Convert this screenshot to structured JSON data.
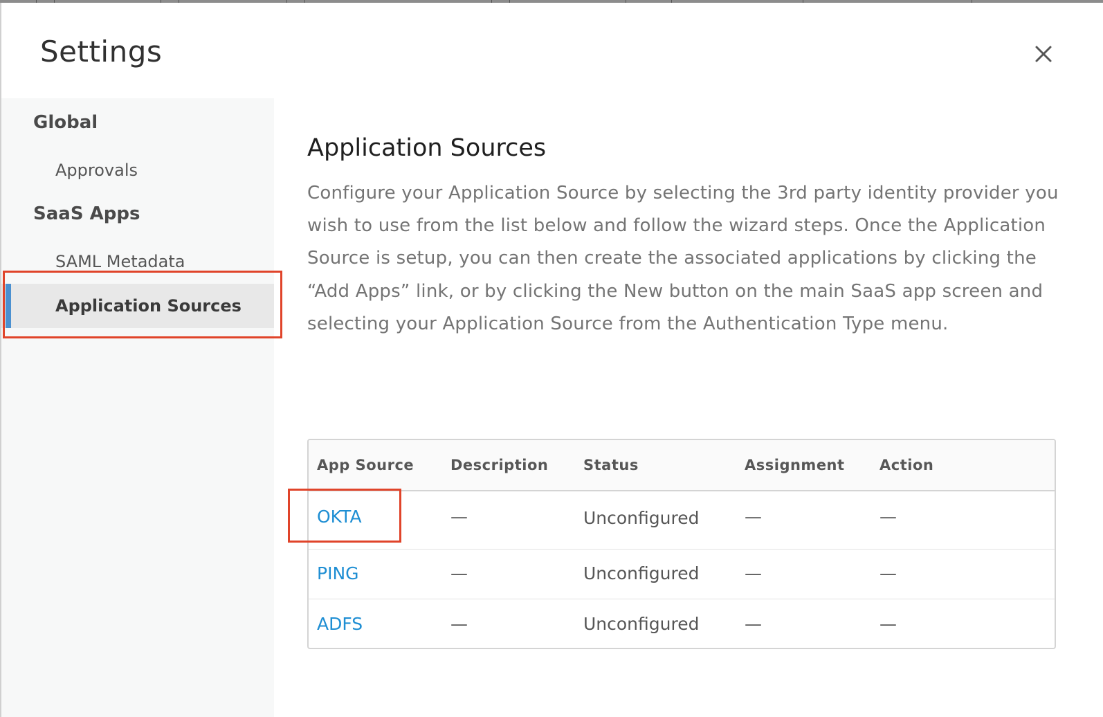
{
  "modal": {
    "title": "Settings",
    "close_icon": "close-icon"
  },
  "sidebar": {
    "groups": [
      {
        "label": "Global",
        "items": [
          {
            "label": "Approvals",
            "active": false
          }
        ]
      },
      {
        "label": "SaaS Apps",
        "items": [
          {
            "label": "SAML Metadata",
            "active": false
          },
          {
            "label": "Application Sources",
            "active": true
          }
        ]
      }
    ]
  },
  "main": {
    "title": "Application Sources",
    "description": "Configure your Application Source by selecting the 3rd party identity provider you wish to use from the list below and follow the wizard steps. Once the Application Source is setup, you can then create the associated applications by clicking the “Add Apps” link, or by clicking the New button on the main SaaS app screen and selecting your Application Source from the Authentication Type menu.",
    "table": {
      "columns": [
        "App Source",
        "Description",
        "Status",
        "Assignment",
        "Action"
      ],
      "rows": [
        {
          "app_source": "OKTA",
          "description": "—",
          "status": "Unconfigured",
          "assignment": "—",
          "action": "—"
        },
        {
          "app_source": "PING",
          "description": "—",
          "status": "Unconfigured",
          "assignment": "—",
          "action": "—"
        },
        {
          "app_source": "ADFS",
          "description": "—",
          "status": "Unconfigured",
          "assignment": "—",
          "action": "—"
        }
      ]
    }
  },
  "colors": {
    "link": "#1e8ed3",
    "active_indicator": "#4a90d0",
    "annotation_highlight": "#e0442a"
  }
}
